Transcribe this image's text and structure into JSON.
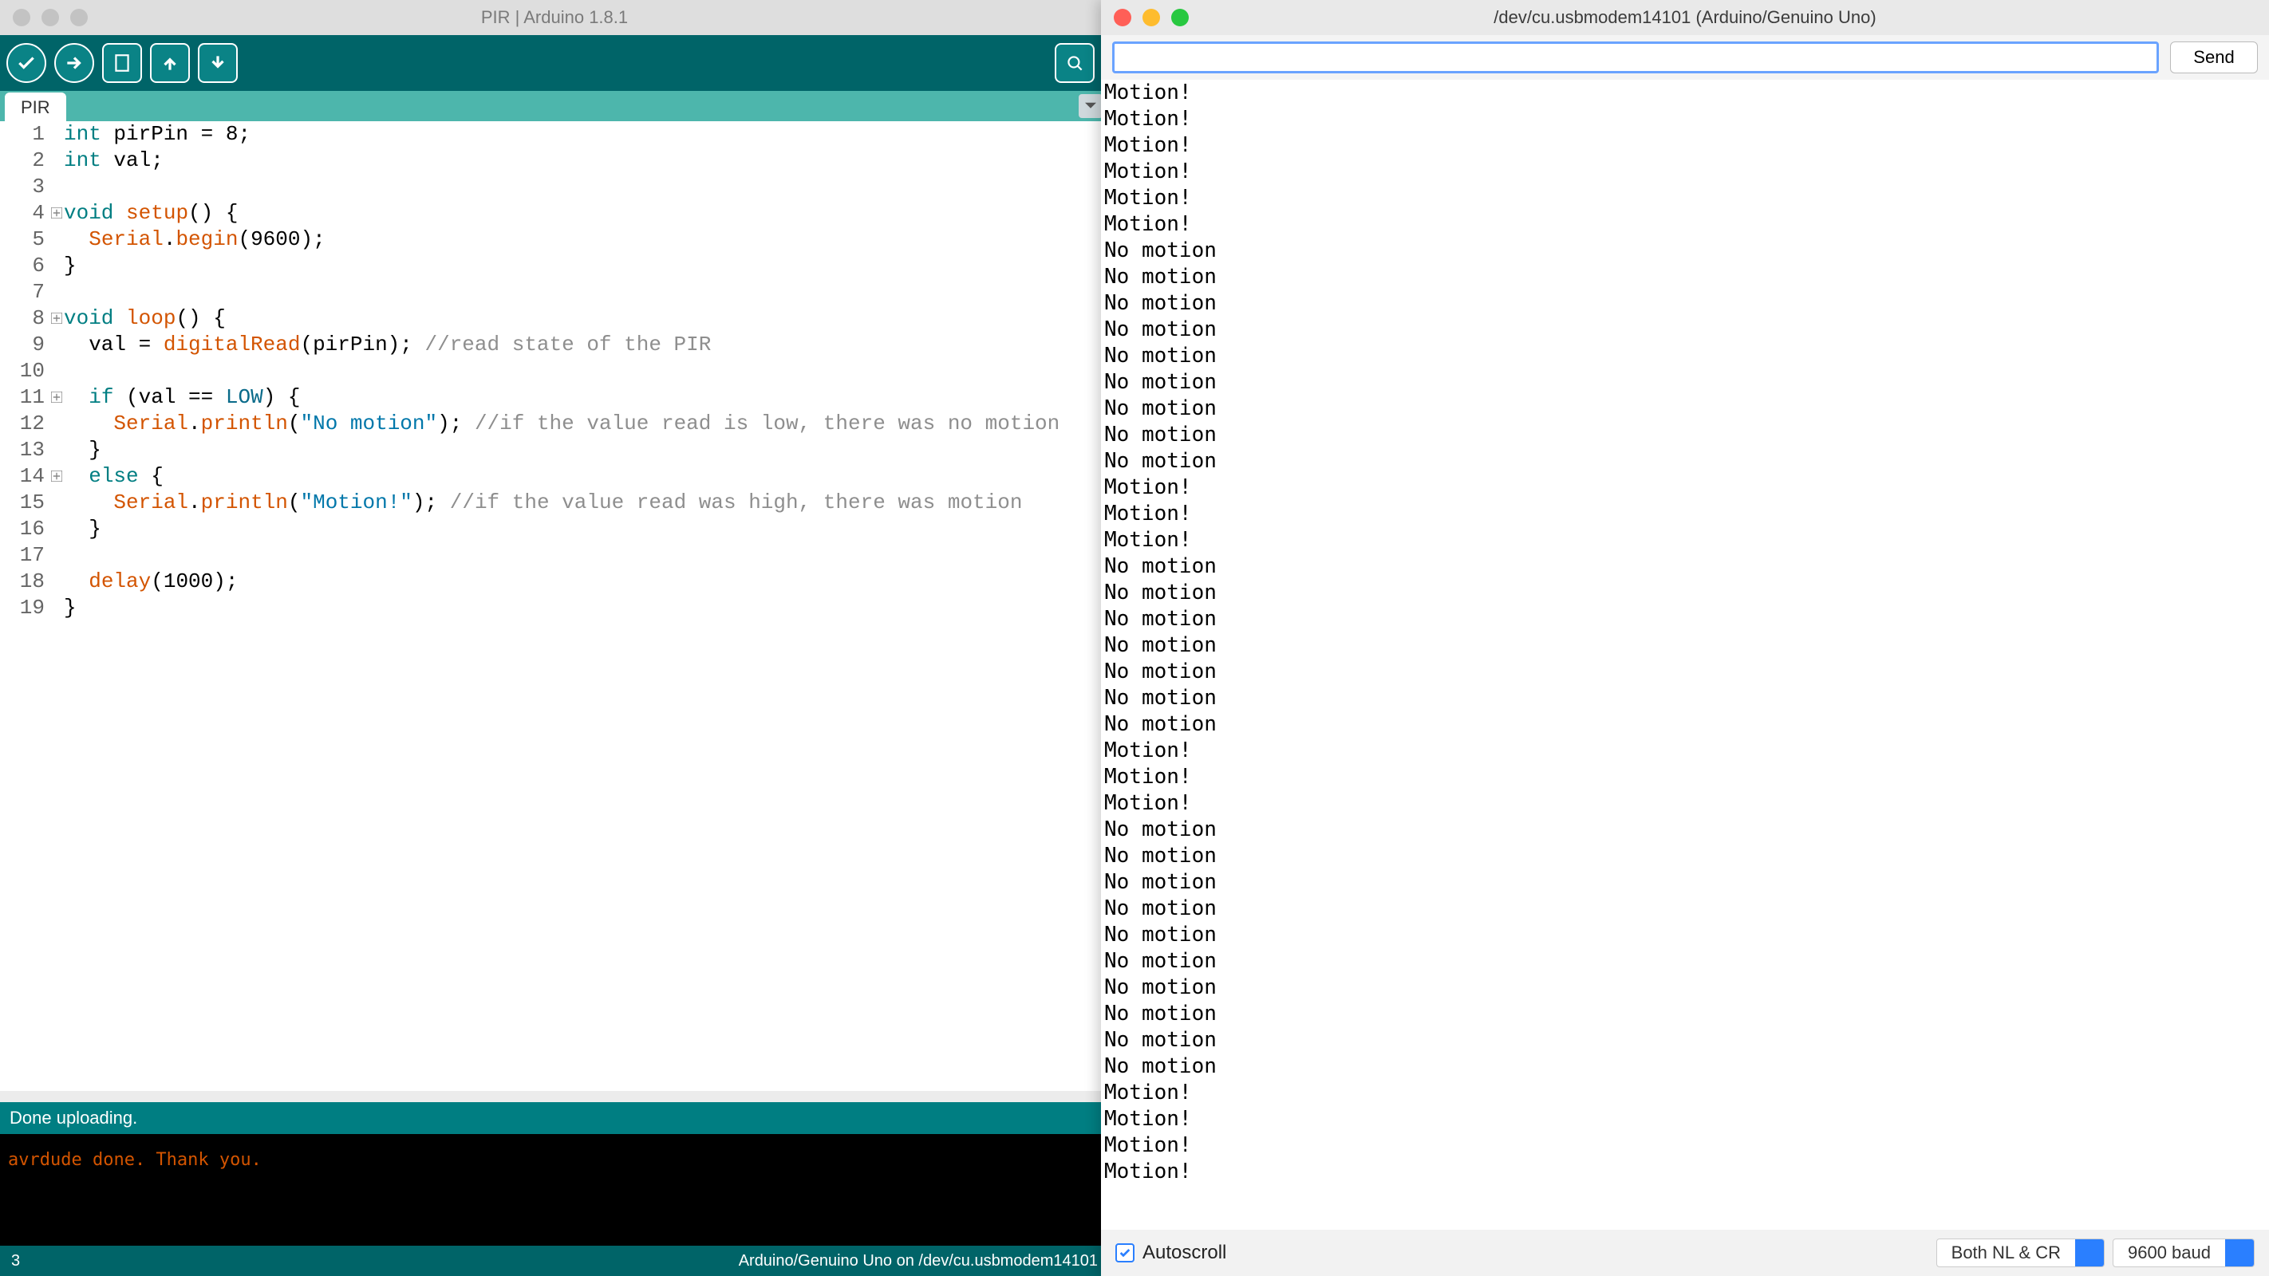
{
  "ide": {
    "title": "PIR | Arduino 1.8.1",
    "tab": "PIR",
    "status": "Done uploading.",
    "console": "avrdude done.  Thank you.",
    "footer_left": "3",
    "footer_right": "Arduino/Genuino Uno on /dev/cu.usbmodem14101",
    "code": [
      {
        "n": "1",
        "t": [
          [
            "kw",
            "int"
          ],
          [
            "lit",
            " pirPin = "
          ],
          [
            "lit",
            "8"
          ],
          [
            "lit",
            ";"
          ]
        ]
      },
      {
        "n": "2",
        "t": [
          [
            "kw",
            "int"
          ],
          [
            "lit",
            " val;"
          ]
        ]
      },
      {
        "n": "3",
        "t": [
          [
            "lit",
            ""
          ]
        ]
      },
      {
        "n": "4",
        "fold": true,
        "t": [
          [
            "kw",
            "void"
          ],
          [
            "lit",
            " "
          ],
          [
            "fn",
            "setup"
          ],
          [
            "lit",
            "() {"
          ]
        ]
      },
      {
        "n": "5",
        "t": [
          [
            "lit",
            "  "
          ],
          [
            "fn",
            "Serial"
          ],
          [
            "lit",
            "."
          ],
          [
            "fn",
            "begin"
          ],
          [
            "lit",
            "("
          ],
          [
            "lit",
            "9600"
          ],
          [
            "lit",
            ");"
          ]
        ]
      },
      {
        "n": "6",
        "t": [
          [
            "lit",
            "}"
          ]
        ]
      },
      {
        "n": "7",
        "t": [
          [
            "lit",
            ""
          ]
        ]
      },
      {
        "n": "8",
        "fold": true,
        "t": [
          [
            "kw",
            "void"
          ],
          [
            "lit",
            " "
          ],
          [
            "fn",
            "loop"
          ],
          [
            "lit",
            "() {"
          ]
        ]
      },
      {
        "n": "9",
        "t": [
          [
            "lit",
            "  val = "
          ],
          [
            "fn",
            "digitalRead"
          ],
          [
            "lit",
            "(pirPin); "
          ],
          [
            "cmt",
            "//read state of the PIR"
          ]
        ]
      },
      {
        "n": "10",
        "t": [
          [
            "lit",
            ""
          ]
        ]
      },
      {
        "n": "11",
        "fold": true,
        "t": [
          [
            "lit",
            "  "
          ],
          [
            "kw",
            "if"
          ],
          [
            "lit",
            " (val == "
          ],
          [
            "low",
            "LOW"
          ],
          [
            "lit",
            ") {"
          ]
        ]
      },
      {
        "n": "12",
        "t": [
          [
            "lit",
            "    "
          ],
          [
            "fn",
            "Serial"
          ],
          [
            "lit",
            "."
          ],
          [
            "fn",
            "println"
          ],
          [
            "lit",
            "("
          ],
          [
            "str",
            "\"No motion\""
          ],
          [
            "lit",
            "); "
          ],
          [
            "cmt",
            "//if the value read is low, there was no motion"
          ]
        ]
      },
      {
        "n": "13",
        "t": [
          [
            "lit",
            "  }"
          ]
        ]
      },
      {
        "n": "14",
        "fold": true,
        "t": [
          [
            "lit",
            "  "
          ],
          [
            "kw",
            "else"
          ],
          [
            "lit",
            " {"
          ]
        ]
      },
      {
        "n": "15",
        "t": [
          [
            "lit",
            "    "
          ],
          [
            "fn",
            "Serial"
          ],
          [
            "lit",
            "."
          ],
          [
            "fn",
            "println"
          ],
          [
            "lit",
            "("
          ],
          [
            "str",
            "\"Motion!\""
          ],
          [
            "lit",
            "); "
          ],
          [
            "cmt",
            "//if the value read was high, there was motion"
          ]
        ]
      },
      {
        "n": "16",
        "t": [
          [
            "lit",
            "  }"
          ]
        ]
      },
      {
        "n": "17",
        "t": [
          [
            "lit",
            ""
          ]
        ]
      },
      {
        "n": "18",
        "t": [
          [
            "lit",
            "  "
          ],
          [
            "fn",
            "delay"
          ],
          [
            "lit",
            "("
          ],
          [
            "lit",
            "1000"
          ],
          [
            "lit",
            ");"
          ]
        ]
      },
      {
        "n": "19",
        "t": [
          [
            "lit",
            "}"
          ]
        ]
      }
    ]
  },
  "serial": {
    "title": "/dev/cu.usbmodem14101 (Arduino/Genuino Uno)",
    "send_label": "Send",
    "input_value": "",
    "autoscroll_label": "Autoscroll",
    "line_ending": "Both NL & CR",
    "baud": "9600 baud",
    "output": [
      "Motion!",
      "Motion!",
      "Motion!",
      "Motion!",
      "Motion!",
      "Motion!",
      "No motion",
      "No motion",
      "No motion",
      "No motion",
      "No motion",
      "No motion",
      "No motion",
      "No motion",
      "No motion",
      "Motion!",
      "Motion!",
      "Motion!",
      "No motion",
      "No motion",
      "No motion",
      "No motion",
      "No motion",
      "No motion",
      "No motion",
      "Motion!",
      "Motion!",
      "Motion!",
      "No motion",
      "No motion",
      "No motion",
      "No motion",
      "No motion",
      "No motion",
      "No motion",
      "No motion",
      "No motion",
      "No motion",
      "Motion!",
      "Motion!",
      "Motion!",
      "Motion!"
    ]
  }
}
